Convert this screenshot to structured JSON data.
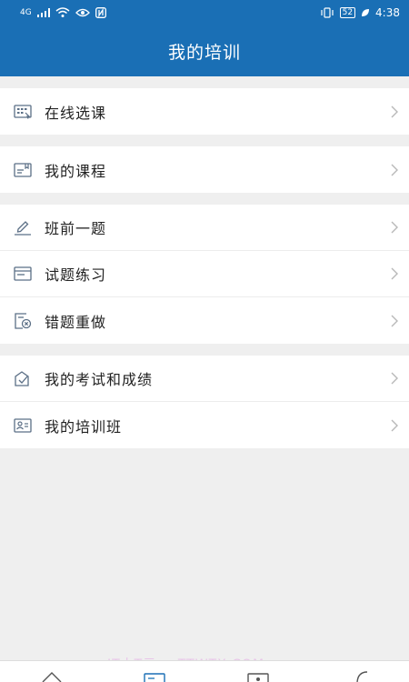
{
  "status": {
    "network_left": "4G",
    "time": "4:38",
    "battery": "52"
  },
  "header": {
    "title": "我的培训"
  },
  "groups": [
    {
      "items": [
        {
          "label": "在线选课",
          "icon": "course-select-icon"
        }
      ]
    },
    {
      "items": [
        {
          "label": "我的课程",
          "icon": "my-course-icon"
        }
      ]
    },
    {
      "items": [
        {
          "label": "班前一题",
          "icon": "pencil-icon"
        },
        {
          "label": "试题练习",
          "icon": "practice-icon"
        },
        {
          "label": "错题重做",
          "icon": "redo-icon"
        }
      ]
    },
    {
      "items": [
        {
          "label": "我的考试和成绩",
          "icon": "exam-icon"
        },
        {
          "label": "我的培训班",
          "icon": "class-icon"
        }
      ]
    }
  ],
  "watermark": "IT小T元 > TTWTX.COM",
  "colors": {
    "brand": "#1a6fb5",
    "background": "#efefef",
    "icon": "#5b6f86"
  }
}
